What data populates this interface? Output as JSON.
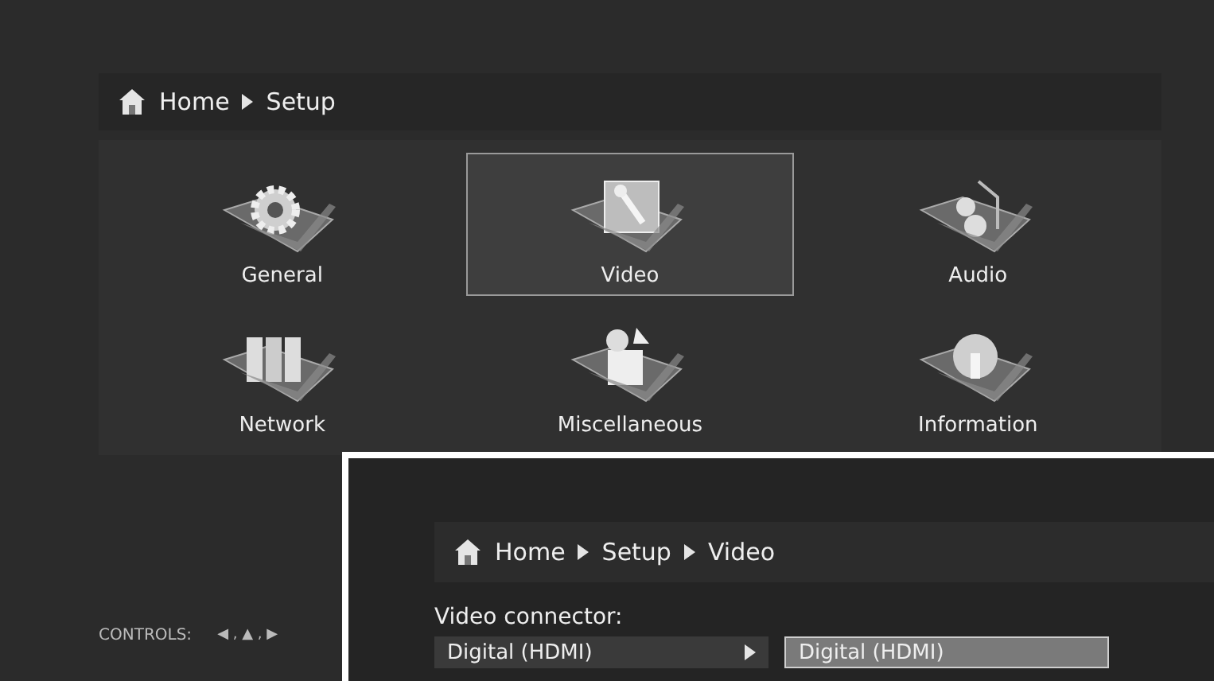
{
  "main": {
    "breadcrumb": [
      "Home",
      "Setup"
    ],
    "items": [
      {
        "label": "General",
        "kind": "gear",
        "selected": false
      },
      {
        "label": "Video",
        "kind": "wrench",
        "selected": true
      },
      {
        "label": "Audio",
        "kind": "music",
        "selected": false
      },
      {
        "label": "Network",
        "kind": "servers",
        "selected": false
      },
      {
        "label": "Miscellaneous",
        "kind": "box",
        "selected": false
      },
      {
        "label": "Information",
        "kind": "info",
        "selected": false
      }
    ],
    "controls": {
      "label": "CONTROLS:",
      "keys": "◀ , ▲ , ▶"
    }
  },
  "inset": {
    "breadcrumb": [
      "Home",
      "Setup",
      "Video"
    ],
    "field_label": "Video connector:",
    "value": "Digital (HDMI)",
    "options": [
      {
        "label": "Digital (HDMI)",
        "selected": true
      }
    ]
  }
}
